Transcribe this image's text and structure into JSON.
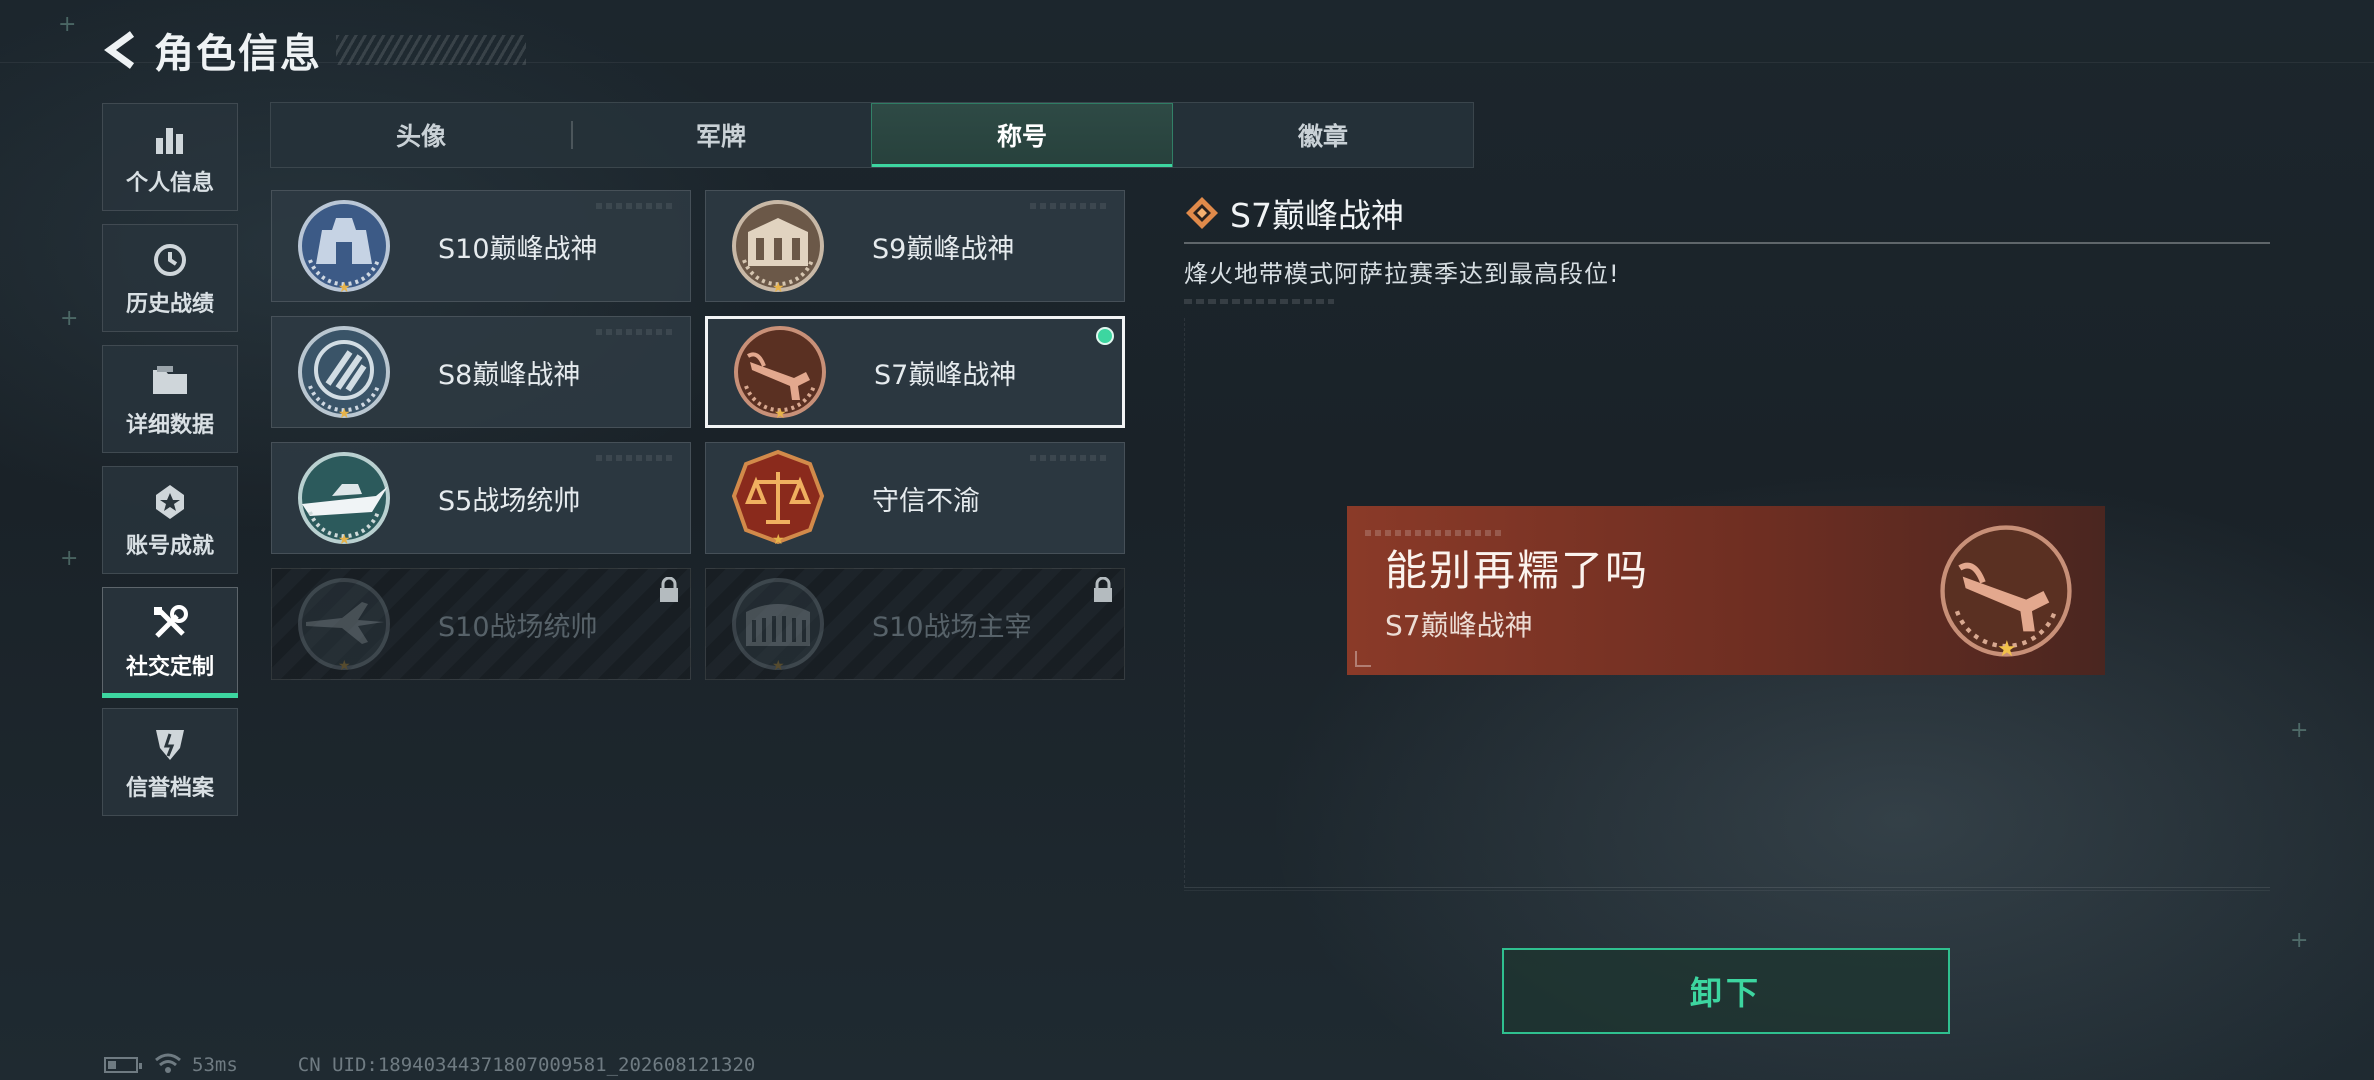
{
  "header": {
    "title": "角色信息"
  },
  "sidebar": {
    "items": [
      {
        "label": "个人信息",
        "icon": "bar-chart-icon"
      },
      {
        "label": "历史战绩",
        "icon": "history-clock-icon"
      },
      {
        "label": "详细数据",
        "icon": "folder-icon"
      },
      {
        "label": "账号成就",
        "icon": "achievement-icon"
      },
      {
        "label": "社交定制",
        "icon": "tools-icon",
        "active": true
      },
      {
        "label": "信誉档案",
        "icon": "credit-shield-icon"
      }
    ]
  },
  "tabs": [
    {
      "label": "头像"
    },
    {
      "label": "军牌"
    },
    {
      "label": "称号",
      "active": true
    },
    {
      "label": "徽章"
    }
  ],
  "titles": [
    {
      "label": "S10巅峰战神",
      "emblem": "fortress-emblem-icon",
      "locked": false
    },
    {
      "label": "S9巅峰战神",
      "emblem": "building-emblem-icon",
      "locked": false
    },
    {
      "label": "S8巅峰战神",
      "emblem": "stripes-emblem-icon",
      "locked": false
    },
    {
      "label": "S7巅峰战神",
      "emblem": "crossbow-emblem-icon",
      "locked": false,
      "selected": true,
      "equipped": true
    },
    {
      "label": "S5战场统帅",
      "emblem": "boat-emblem-icon",
      "locked": false
    },
    {
      "label": "守信不渝",
      "emblem": "scales-emblem-icon",
      "locked": false
    },
    {
      "label": "S10战场统帅",
      "emblem": "jet-emblem-icon",
      "locked": true
    },
    {
      "label": "S10战场主宰",
      "emblem": "colosseum-emblem-icon",
      "locked": true
    }
  ],
  "detail": {
    "title": "S7巅峰战神",
    "description": "烽火地带模式阿萨拉赛季达到最高段位!"
  },
  "preview": {
    "player_name": "能别再糯了吗",
    "title": "S7巅峰战神"
  },
  "actions": {
    "unequip_label": "卸下"
  },
  "status": {
    "ping": "53ms",
    "uid": "CN UID:18940344371807009581_202608121320"
  },
  "colors": {
    "accent": "#3dd6a0",
    "preview_bg": "#7a3324",
    "star": "#e7b34a"
  }
}
